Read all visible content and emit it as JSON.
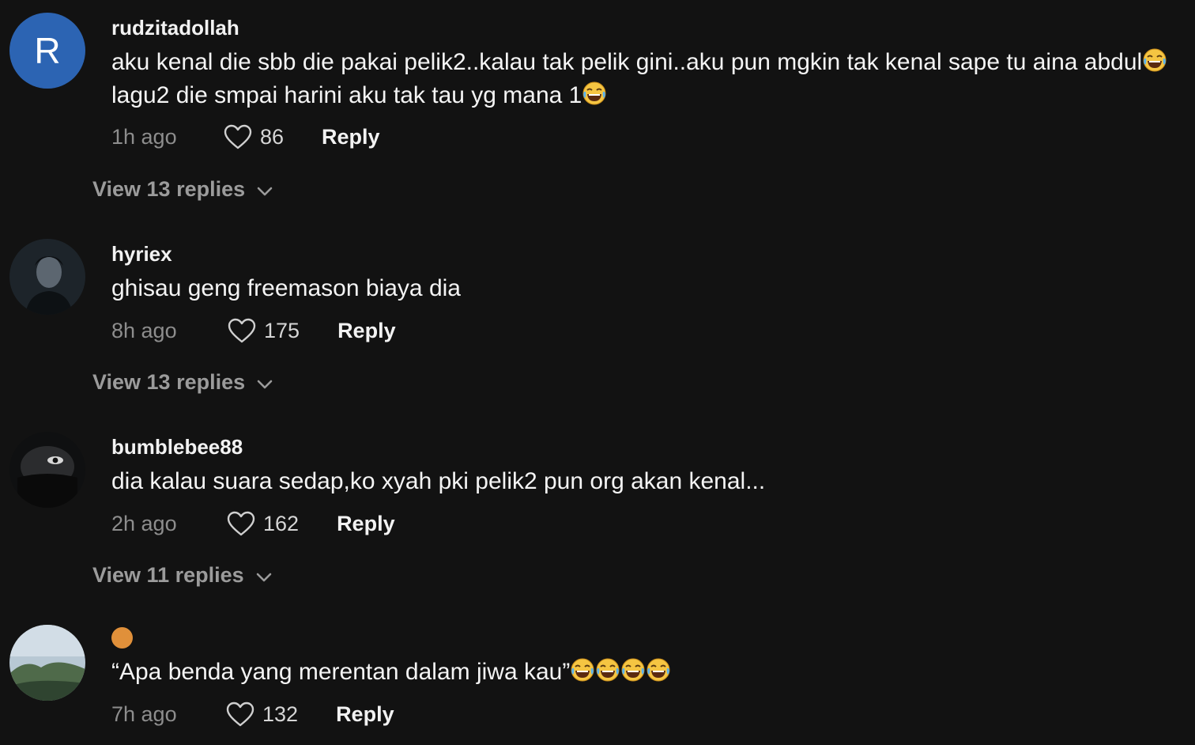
{
  "comments": [
    {
      "avatar_letter": "R",
      "username": "rudzitadollah",
      "text_a": "aku kenal die sbb die pakai pelik2..kalau tak pelik gini..aku pun mgkin tak kenal sape tu aina abdul",
      "text_b": " lagu2 die smpai harini aku tak tau yg mana 1",
      "time": "1h ago",
      "likes": "86",
      "reply_label": "Reply",
      "view_replies": "View 13 replies"
    },
    {
      "username": "hyriex",
      "text": "ghisau geng freemason biaya dia",
      "time": "8h ago",
      "likes": "175",
      "reply_label": "Reply",
      "view_replies": "View 13 replies"
    },
    {
      "username": "bumblebee88",
      "text": "dia kalau suara sedap,ko xyah pki pelik2 pun org akan kenal...",
      "time": "2h ago",
      "likes": "162",
      "reply_label": "Reply",
      "view_replies": "View 11 replies"
    },
    {
      "text": "“Apa benda yang merentan dalam jiwa kau”",
      "time": "7h ago",
      "likes": "132",
      "reply_label": "Reply"
    }
  ],
  "icons": {
    "like": "heart-outline-icon",
    "expand": "chevron-down-icon",
    "emoji": "laughing-tears-emoji"
  },
  "colors": {
    "background": "#121212",
    "avatar_letter_bg": "#2c64b3",
    "secondary_text": "#8d8d8d",
    "username_dot": "#e0903a"
  }
}
